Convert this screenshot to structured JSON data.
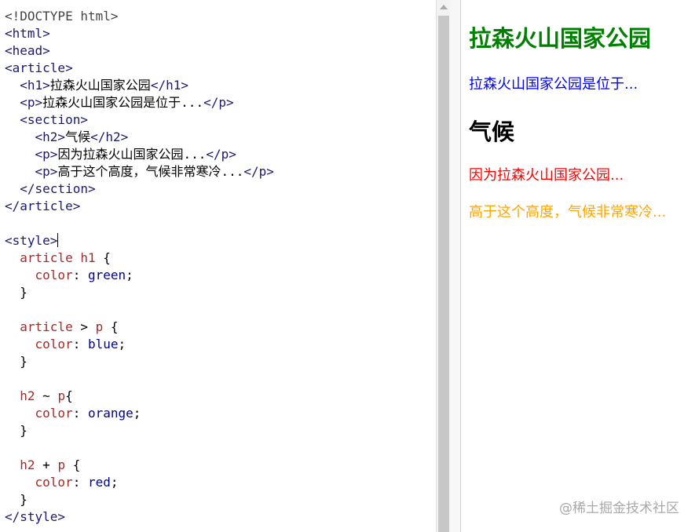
{
  "editor": {
    "lines": [
      [
        {
          "t": "<!DOCTYPE html>",
          "c": "gray"
        }
      ],
      [
        {
          "t": "<html>",
          "c": "navy"
        }
      ],
      [
        {
          "t": "<head>",
          "c": "navy"
        }
      ],
      [
        {
          "t": "<article>",
          "c": "navy"
        }
      ],
      [
        {
          "t": "  ",
          "c": ""
        },
        {
          "t": "<h1>",
          "c": "navy"
        },
        {
          "t": "拉森火山国家公园",
          "c": ""
        },
        {
          "t": "</h1>",
          "c": "navy"
        }
      ],
      [
        {
          "t": "  ",
          "c": ""
        },
        {
          "t": "<p>",
          "c": "navy"
        },
        {
          "t": "拉森火山国家公园是位于...",
          "c": ""
        },
        {
          "t": "</p>",
          "c": "navy"
        }
      ],
      [
        {
          "t": "  ",
          "c": ""
        },
        {
          "t": "<section>",
          "c": "navy"
        }
      ],
      [
        {
          "t": "    ",
          "c": ""
        },
        {
          "t": "<h2>",
          "c": "navy"
        },
        {
          "t": "气候",
          "c": ""
        },
        {
          "t": "</h2>",
          "c": "navy"
        }
      ],
      [
        {
          "t": "    ",
          "c": ""
        },
        {
          "t": "<p>",
          "c": "navy"
        },
        {
          "t": "因为拉森火山国家公园...",
          "c": ""
        },
        {
          "t": "</p>",
          "c": "navy"
        }
      ],
      [
        {
          "t": "    ",
          "c": ""
        },
        {
          "t": "<p>",
          "c": "navy"
        },
        {
          "t": "高于这个高度，气候非常寒冷...",
          "c": ""
        },
        {
          "t": "</p>",
          "c": "navy"
        }
      ],
      [
        {
          "t": "  ",
          "c": ""
        },
        {
          "t": "</section>",
          "c": "navy"
        }
      ],
      [
        {
          "t": "</article>",
          "c": "navy"
        }
      ],
      [],
      [
        {
          "t": "<style>",
          "c": "navy"
        },
        {
          "t": "",
          "c": "caret"
        }
      ],
      [
        {
          "t": "  ",
          "c": ""
        },
        {
          "t": "article h1",
          "c": "brown"
        },
        {
          "t": " {",
          "c": ""
        }
      ],
      [
        {
          "t": "    ",
          "c": ""
        },
        {
          "t": "color",
          "c": "brown"
        },
        {
          "t": ": ",
          "c": ""
        },
        {
          "t": "green",
          "c": "blue"
        },
        {
          "t": ";",
          "c": ""
        }
      ],
      [
        {
          "t": "  }",
          "c": ""
        }
      ],
      [],
      [
        {
          "t": "  ",
          "c": ""
        },
        {
          "t": "article",
          "c": "brown"
        },
        {
          "t": " > ",
          "c": ""
        },
        {
          "t": "p",
          "c": "brown"
        },
        {
          "t": " {",
          "c": ""
        }
      ],
      [
        {
          "t": "    ",
          "c": ""
        },
        {
          "t": "color",
          "c": "brown"
        },
        {
          "t": ": ",
          "c": ""
        },
        {
          "t": "blue",
          "c": "blue"
        },
        {
          "t": ";",
          "c": ""
        }
      ],
      [
        {
          "t": "  }",
          "c": ""
        }
      ],
      [],
      [
        {
          "t": "  ",
          "c": ""
        },
        {
          "t": "h2",
          "c": "brown"
        },
        {
          "t": " ~ ",
          "c": ""
        },
        {
          "t": "p",
          "c": "brown"
        },
        {
          "t": "{",
          "c": ""
        }
      ],
      [
        {
          "t": "    ",
          "c": ""
        },
        {
          "t": "color",
          "c": "brown"
        },
        {
          "t": ": ",
          "c": ""
        },
        {
          "t": "orange",
          "c": "blue"
        },
        {
          "t": ";",
          "c": ""
        }
      ],
      [
        {
          "t": "  }",
          "c": ""
        }
      ],
      [],
      [
        {
          "t": "  ",
          "c": ""
        },
        {
          "t": "h2",
          "c": "brown"
        },
        {
          "t": " + ",
          "c": ""
        },
        {
          "t": "p",
          "c": "brown"
        },
        {
          "t": " {",
          "c": ""
        }
      ],
      [
        {
          "t": "    ",
          "c": ""
        },
        {
          "t": "color",
          "c": "brown"
        },
        {
          "t": ": ",
          "c": ""
        },
        {
          "t": "red",
          "c": "blue"
        },
        {
          "t": ";",
          "c": ""
        }
      ],
      [
        {
          "t": "  }",
          "c": ""
        }
      ],
      [
        {
          "t": "</style>",
          "c": "navy"
        }
      ]
    ]
  },
  "preview": {
    "h1": "拉森火山国家公园",
    "p1": "拉森火山国家公园是位于...",
    "h2": "气候",
    "p2": "因为拉森火山国家公园...",
    "p3": "高于这个高度，气候非常寒冷..."
  },
  "watermark": "@稀土掘金技术社区",
  "colors": {
    "tag": "#1a1a6e",
    "selector": "#a52a2a",
    "value": "#00008b",
    "h1": "green",
    "p1": "blue",
    "p2": "red",
    "p3": "orange"
  }
}
